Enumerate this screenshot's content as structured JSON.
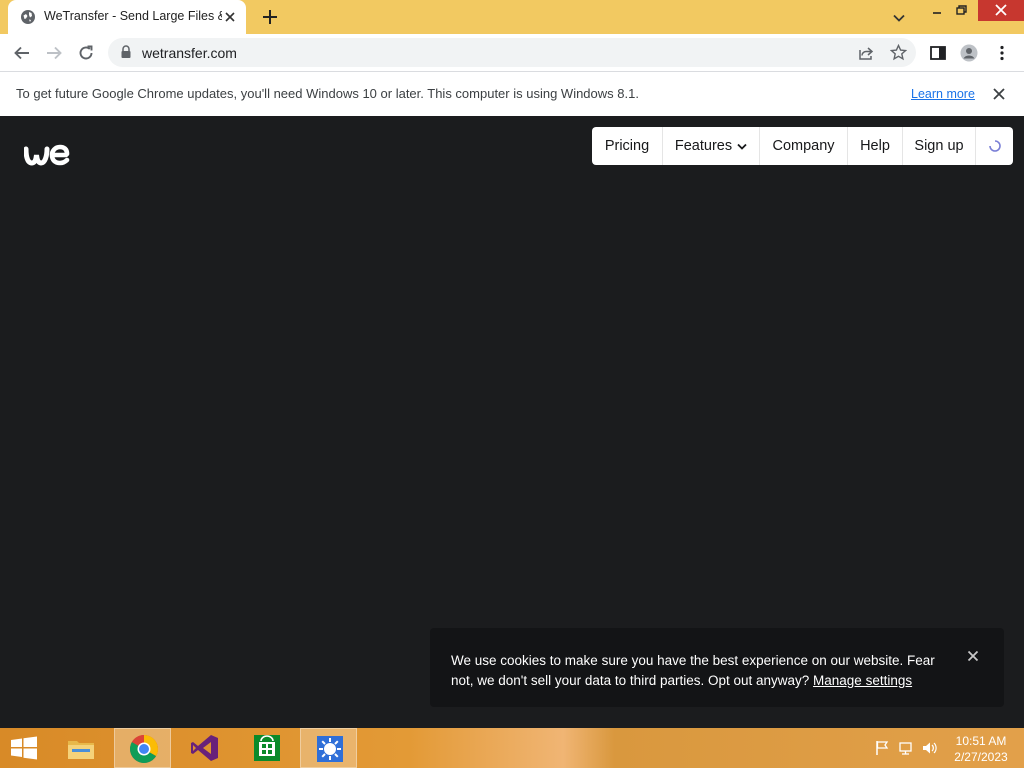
{
  "browser": {
    "tab": {
      "title": "WeTransfer - Send Large Files &"
    },
    "address": {
      "url": "wetransfer.com"
    },
    "infobar": {
      "message": "To get future Google Chrome updates, you'll need Windows 10 or later. This computer is using Windows 8.1.",
      "link": "Learn more"
    }
  },
  "page": {
    "nav": {
      "items": [
        {
          "label": "Pricing"
        },
        {
          "label": "Features"
        },
        {
          "label": "Company"
        },
        {
          "label": "Help"
        },
        {
          "label": "Sign up"
        }
      ]
    },
    "cookie": {
      "text": "We use cookies to make sure you have the best experience on our website. Fear not, we don't sell your data to third parties. Opt out anyway? ",
      "link": "Manage settings"
    }
  },
  "taskbar": {
    "apps": [
      "file-explorer",
      "chrome",
      "visual-studio",
      "store",
      "settings"
    ],
    "clock": {
      "time": "10:51 AM",
      "date": "2/27/2023"
    }
  },
  "colors": {
    "tabstrip": "#f2c961",
    "page_background": "#1b1c1e",
    "close_button": "#c7372f",
    "link": "#1a73e8"
  }
}
